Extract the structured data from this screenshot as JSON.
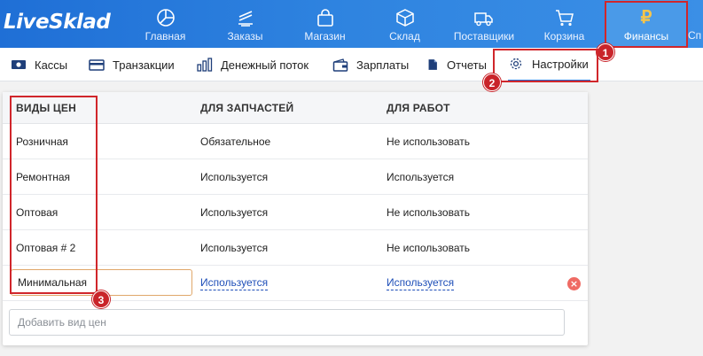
{
  "app": {
    "logo": "LiveSklad"
  },
  "topnav": {
    "items": [
      {
        "label": "Главная",
        "icon": "dashboard-icon"
      },
      {
        "label": "Заказы",
        "icon": "orders-icon"
      },
      {
        "label": "Магазин",
        "icon": "shop-bag-icon"
      },
      {
        "label": "Склад",
        "icon": "box-icon"
      },
      {
        "label": "Поставщики",
        "icon": "truck-icon"
      },
      {
        "label": "Корзина",
        "icon": "cart-icon"
      },
      {
        "label": "Финансы",
        "icon": "ruble-icon",
        "glyph": "₽",
        "active": true
      },
      {
        "label": "Сп",
        "icon": "cut-off-item"
      }
    ]
  },
  "subnav": {
    "items": [
      {
        "label": "Кассы",
        "icon": "cash-icon"
      },
      {
        "label": "Транзакции",
        "icon": "card-icon"
      },
      {
        "label": "Денежный поток",
        "icon": "bar-chart-icon"
      },
      {
        "label": "Зарплаты",
        "icon": "wallet-icon"
      },
      {
        "label": "Отчеты",
        "icon": "report-icon"
      },
      {
        "label": "Настройки",
        "icon": "gear-icon",
        "active": true
      }
    ]
  },
  "table": {
    "headers": [
      "ВИДЫ ЦЕН",
      "ДЛЯ ЗАПЧАСТЕЙ",
      "ДЛЯ РАБОТ"
    ],
    "rows": [
      [
        "Розничная",
        "Обязательное",
        "Не использовать"
      ],
      [
        "Ремонтная",
        "Используется",
        "Используется"
      ],
      [
        "Оптовая",
        "Используется",
        "Не использовать"
      ],
      [
        "Оптовая # 2",
        "Используется",
        "Не использовать"
      ]
    ],
    "edit_row": {
      "name": "Минимальная",
      "parts": "Используется",
      "work": "Используется"
    },
    "add_placeholder": "Добавить вид цен"
  },
  "annotations": [
    "1",
    "2",
    "3"
  ],
  "colors": {
    "nav_bg": "#2f84e0",
    "active_nav": "#4a9ae8",
    "accent": "#1f6fd6",
    "annotation": "#d0262b",
    "delete": "#ef6b64",
    "edit_border": "#e0a76a"
  }
}
